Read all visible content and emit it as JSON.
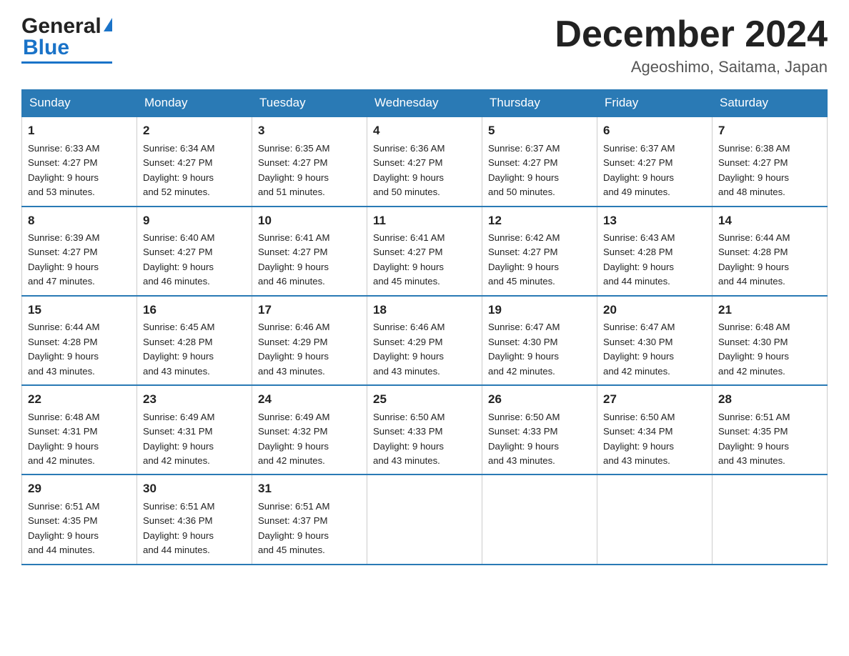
{
  "header": {
    "logo_general": "General",
    "logo_blue": "Blue",
    "month_title": "December 2024",
    "location": "Ageoshimo, Saitama, Japan"
  },
  "days_of_week": [
    "Sunday",
    "Monday",
    "Tuesday",
    "Wednesday",
    "Thursday",
    "Friday",
    "Saturday"
  ],
  "weeks": [
    [
      {
        "day": "1",
        "sunrise": "6:33 AM",
        "sunset": "4:27 PM",
        "daylight": "9 hours and 53 minutes."
      },
      {
        "day": "2",
        "sunrise": "6:34 AM",
        "sunset": "4:27 PM",
        "daylight": "9 hours and 52 minutes."
      },
      {
        "day": "3",
        "sunrise": "6:35 AM",
        "sunset": "4:27 PM",
        "daylight": "9 hours and 51 minutes."
      },
      {
        "day": "4",
        "sunrise": "6:36 AM",
        "sunset": "4:27 PM",
        "daylight": "9 hours and 50 minutes."
      },
      {
        "day": "5",
        "sunrise": "6:37 AM",
        "sunset": "4:27 PM",
        "daylight": "9 hours and 50 minutes."
      },
      {
        "day": "6",
        "sunrise": "6:37 AM",
        "sunset": "4:27 PM",
        "daylight": "9 hours and 49 minutes."
      },
      {
        "day": "7",
        "sunrise": "6:38 AM",
        "sunset": "4:27 PM",
        "daylight": "9 hours and 48 minutes."
      }
    ],
    [
      {
        "day": "8",
        "sunrise": "6:39 AM",
        "sunset": "4:27 PM",
        "daylight": "9 hours and 47 minutes."
      },
      {
        "day": "9",
        "sunrise": "6:40 AM",
        "sunset": "4:27 PM",
        "daylight": "9 hours and 46 minutes."
      },
      {
        "day": "10",
        "sunrise": "6:41 AM",
        "sunset": "4:27 PM",
        "daylight": "9 hours and 46 minutes."
      },
      {
        "day": "11",
        "sunrise": "6:41 AM",
        "sunset": "4:27 PM",
        "daylight": "9 hours and 45 minutes."
      },
      {
        "day": "12",
        "sunrise": "6:42 AM",
        "sunset": "4:27 PM",
        "daylight": "9 hours and 45 minutes."
      },
      {
        "day": "13",
        "sunrise": "6:43 AM",
        "sunset": "4:28 PM",
        "daylight": "9 hours and 44 minutes."
      },
      {
        "day": "14",
        "sunrise": "6:44 AM",
        "sunset": "4:28 PM",
        "daylight": "9 hours and 44 minutes."
      }
    ],
    [
      {
        "day": "15",
        "sunrise": "6:44 AM",
        "sunset": "4:28 PM",
        "daylight": "9 hours and 43 minutes."
      },
      {
        "day": "16",
        "sunrise": "6:45 AM",
        "sunset": "4:28 PM",
        "daylight": "9 hours and 43 minutes."
      },
      {
        "day": "17",
        "sunrise": "6:46 AM",
        "sunset": "4:29 PM",
        "daylight": "9 hours and 43 minutes."
      },
      {
        "day": "18",
        "sunrise": "6:46 AM",
        "sunset": "4:29 PM",
        "daylight": "9 hours and 43 minutes."
      },
      {
        "day": "19",
        "sunrise": "6:47 AM",
        "sunset": "4:30 PM",
        "daylight": "9 hours and 42 minutes."
      },
      {
        "day": "20",
        "sunrise": "6:47 AM",
        "sunset": "4:30 PM",
        "daylight": "9 hours and 42 minutes."
      },
      {
        "day": "21",
        "sunrise": "6:48 AM",
        "sunset": "4:30 PM",
        "daylight": "9 hours and 42 minutes."
      }
    ],
    [
      {
        "day": "22",
        "sunrise": "6:48 AM",
        "sunset": "4:31 PM",
        "daylight": "9 hours and 42 minutes."
      },
      {
        "day": "23",
        "sunrise": "6:49 AM",
        "sunset": "4:31 PM",
        "daylight": "9 hours and 42 minutes."
      },
      {
        "day": "24",
        "sunrise": "6:49 AM",
        "sunset": "4:32 PM",
        "daylight": "9 hours and 42 minutes."
      },
      {
        "day": "25",
        "sunrise": "6:50 AM",
        "sunset": "4:33 PM",
        "daylight": "9 hours and 43 minutes."
      },
      {
        "day": "26",
        "sunrise": "6:50 AM",
        "sunset": "4:33 PM",
        "daylight": "9 hours and 43 minutes."
      },
      {
        "day": "27",
        "sunrise": "6:50 AM",
        "sunset": "4:34 PM",
        "daylight": "9 hours and 43 minutes."
      },
      {
        "day": "28",
        "sunrise": "6:51 AM",
        "sunset": "4:35 PM",
        "daylight": "9 hours and 43 minutes."
      }
    ],
    [
      {
        "day": "29",
        "sunrise": "6:51 AM",
        "sunset": "4:35 PM",
        "daylight": "9 hours and 44 minutes."
      },
      {
        "day": "30",
        "sunrise": "6:51 AM",
        "sunset": "4:36 PM",
        "daylight": "9 hours and 44 minutes."
      },
      {
        "day": "31",
        "sunrise": "6:51 AM",
        "sunset": "4:37 PM",
        "daylight": "9 hours and 45 minutes."
      },
      null,
      null,
      null,
      null
    ]
  ],
  "labels": {
    "sunrise": "Sunrise:",
    "sunset": "Sunset:",
    "daylight": "Daylight:"
  }
}
